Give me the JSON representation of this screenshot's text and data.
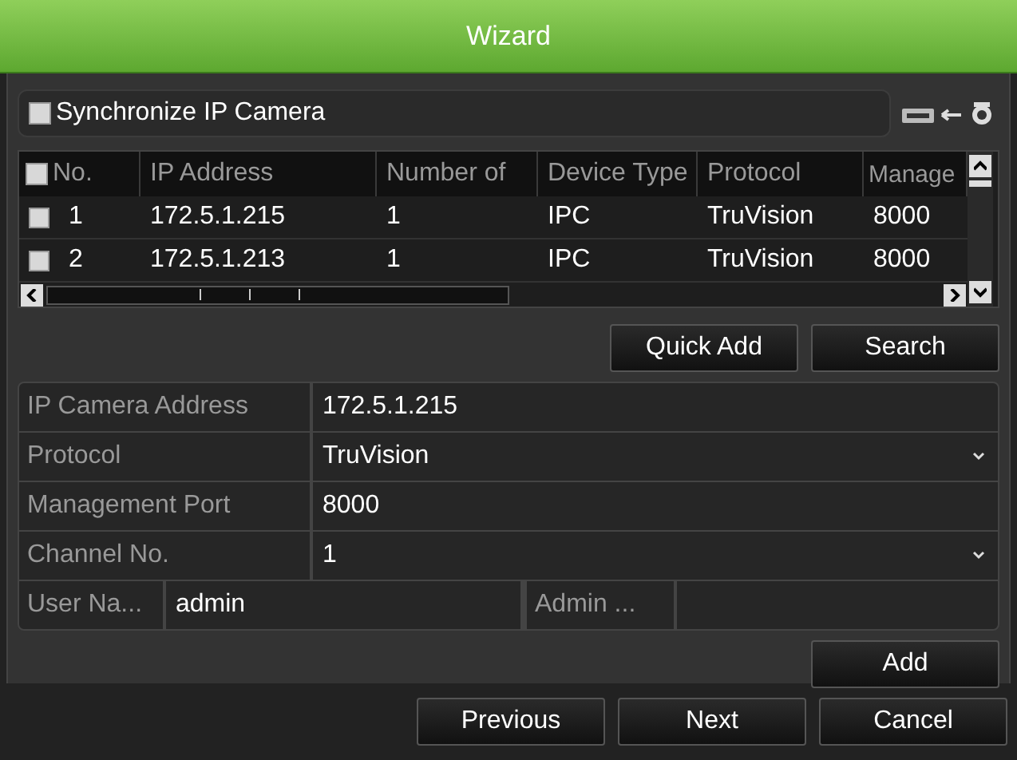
{
  "window": {
    "title": "Wizard"
  },
  "sync": {
    "label": "Synchronize IP Camera",
    "checked": false
  },
  "table": {
    "columns": [
      "No.",
      "IP Address",
      "Number of",
      "Device Type",
      "Protocol",
      "Manage"
    ],
    "all_checked": false,
    "rows": [
      {
        "checked": false,
        "cells": [
          "1",
          "172.5.1.215",
          "1",
          "IPC",
          "TruVision",
          "8000"
        ]
      },
      {
        "checked": false,
        "cells": [
          "2",
          "172.5.1.213",
          "1",
          "IPC",
          "TruVision",
          "8000"
        ]
      }
    ]
  },
  "table_buttons": [
    "Quick Add",
    "Search"
  ],
  "form": [
    {
      "kind": "text",
      "label": "IP Camera Address",
      "value": "172.5.1.215"
    },
    {
      "kind": "dropdown",
      "label": "Protocol",
      "value": "TruVision"
    },
    {
      "kind": "text",
      "label": "Management Port",
      "value": "8000"
    },
    {
      "kind": "dropdown",
      "label": "Channel No.",
      "value": "1"
    }
  ],
  "credentials": {
    "user_label": "User Na...",
    "user_value": "admin",
    "password_label": "Admin ..."
  },
  "add_button": "Add",
  "footer_buttons": [
    "Previous",
    "Next",
    "Cancel"
  ]
}
